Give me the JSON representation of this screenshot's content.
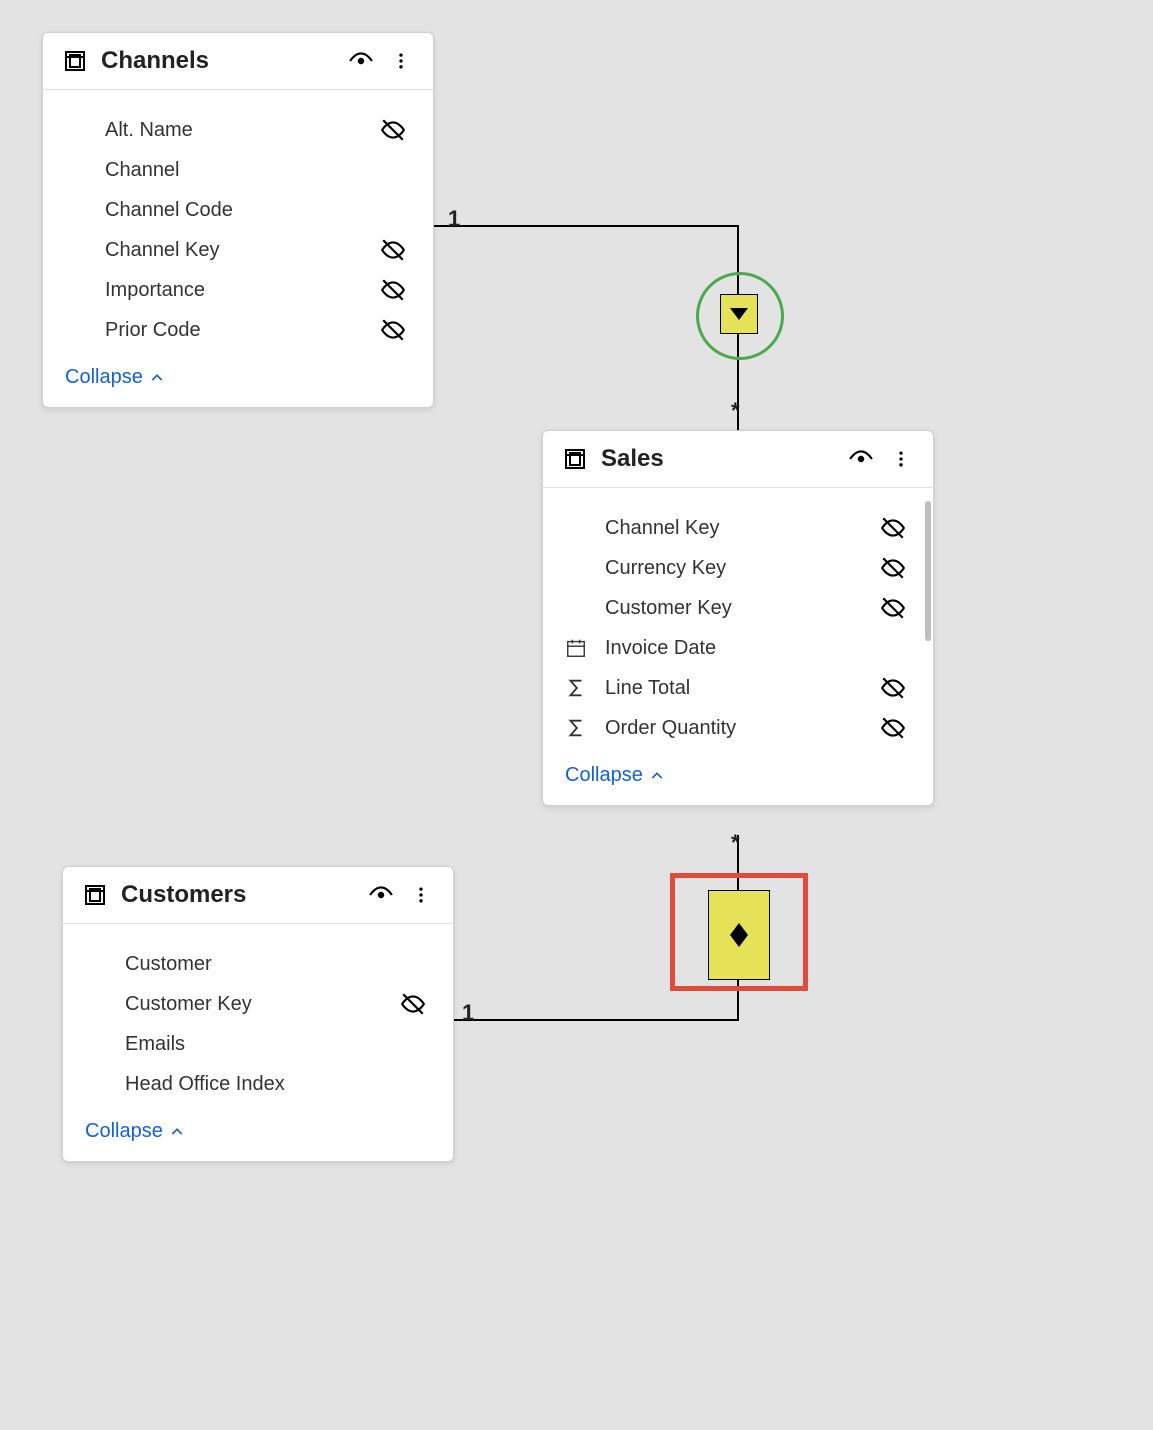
{
  "ui": {
    "collapse_label": "Collapse"
  },
  "tables": {
    "channels": {
      "title": "Channels",
      "fields": [
        {
          "name": "Alt. Name",
          "hidden": true,
          "type": "text"
        },
        {
          "name": "Channel",
          "hidden": false,
          "type": "text"
        },
        {
          "name": "Channel Code",
          "hidden": false,
          "type": "text"
        },
        {
          "name": "Channel Key",
          "hidden": true,
          "type": "text"
        },
        {
          "name": "Importance",
          "hidden": true,
          "type": "text"
        },
        {
          "name": "Prior Code",
          "hidden": true,
          "type": "text"
        }
      ]
    },
    "sales": {
      "title": "Sales",
      "fields": [
        {
          "name": "Channel Key",
          "hidden": true,
          "type": "text"
        },
        {
          "name": "Currency Key",
          "hidden": true,
          "type": "text"
        },
        {
          "name": "Customer Key",
          "hidden": true,
          "type": "text"
        },
        {
          "name": "Invoice Date",
          "hidden": false,
          "type": "date"
        },
        {
          "name": "Line Total",
          "hidden": true,
          "type": "sum"
        },
        {
          "name": "Order Quantity",
          "hidden": true,
          "type": "sum"
        }
      ]
    },
    "customers": {
      "title": "Customers",
      "fields": [
        {
          "name": "Customer",
          "hidden": false,
          "type": "text"
        },
        {
          "name": "Customer Key",
          "hidden": true,
          "type": "text"
        },
        {
          "name": "Emails",
          "hidden": false,
          "type": "text"
        },
        {
          "name": "Head Office Index",
          "hidden": false,
          "type": "text"
        }
      ]
    }
  },
  "relationships": [
    {
      "from": "channels",
      "from_card": "1",
      "to": "sales",
      "to_card": "*",
      "direction": "single",
      "highlight": "green-circle"
    },
    {
      "from": "customers",
      "from_card": "1",
      "to": "sales",
      "to_card": "*",
      "direction": "both",
      "highlight": "red-box"
    }
  ]
}
